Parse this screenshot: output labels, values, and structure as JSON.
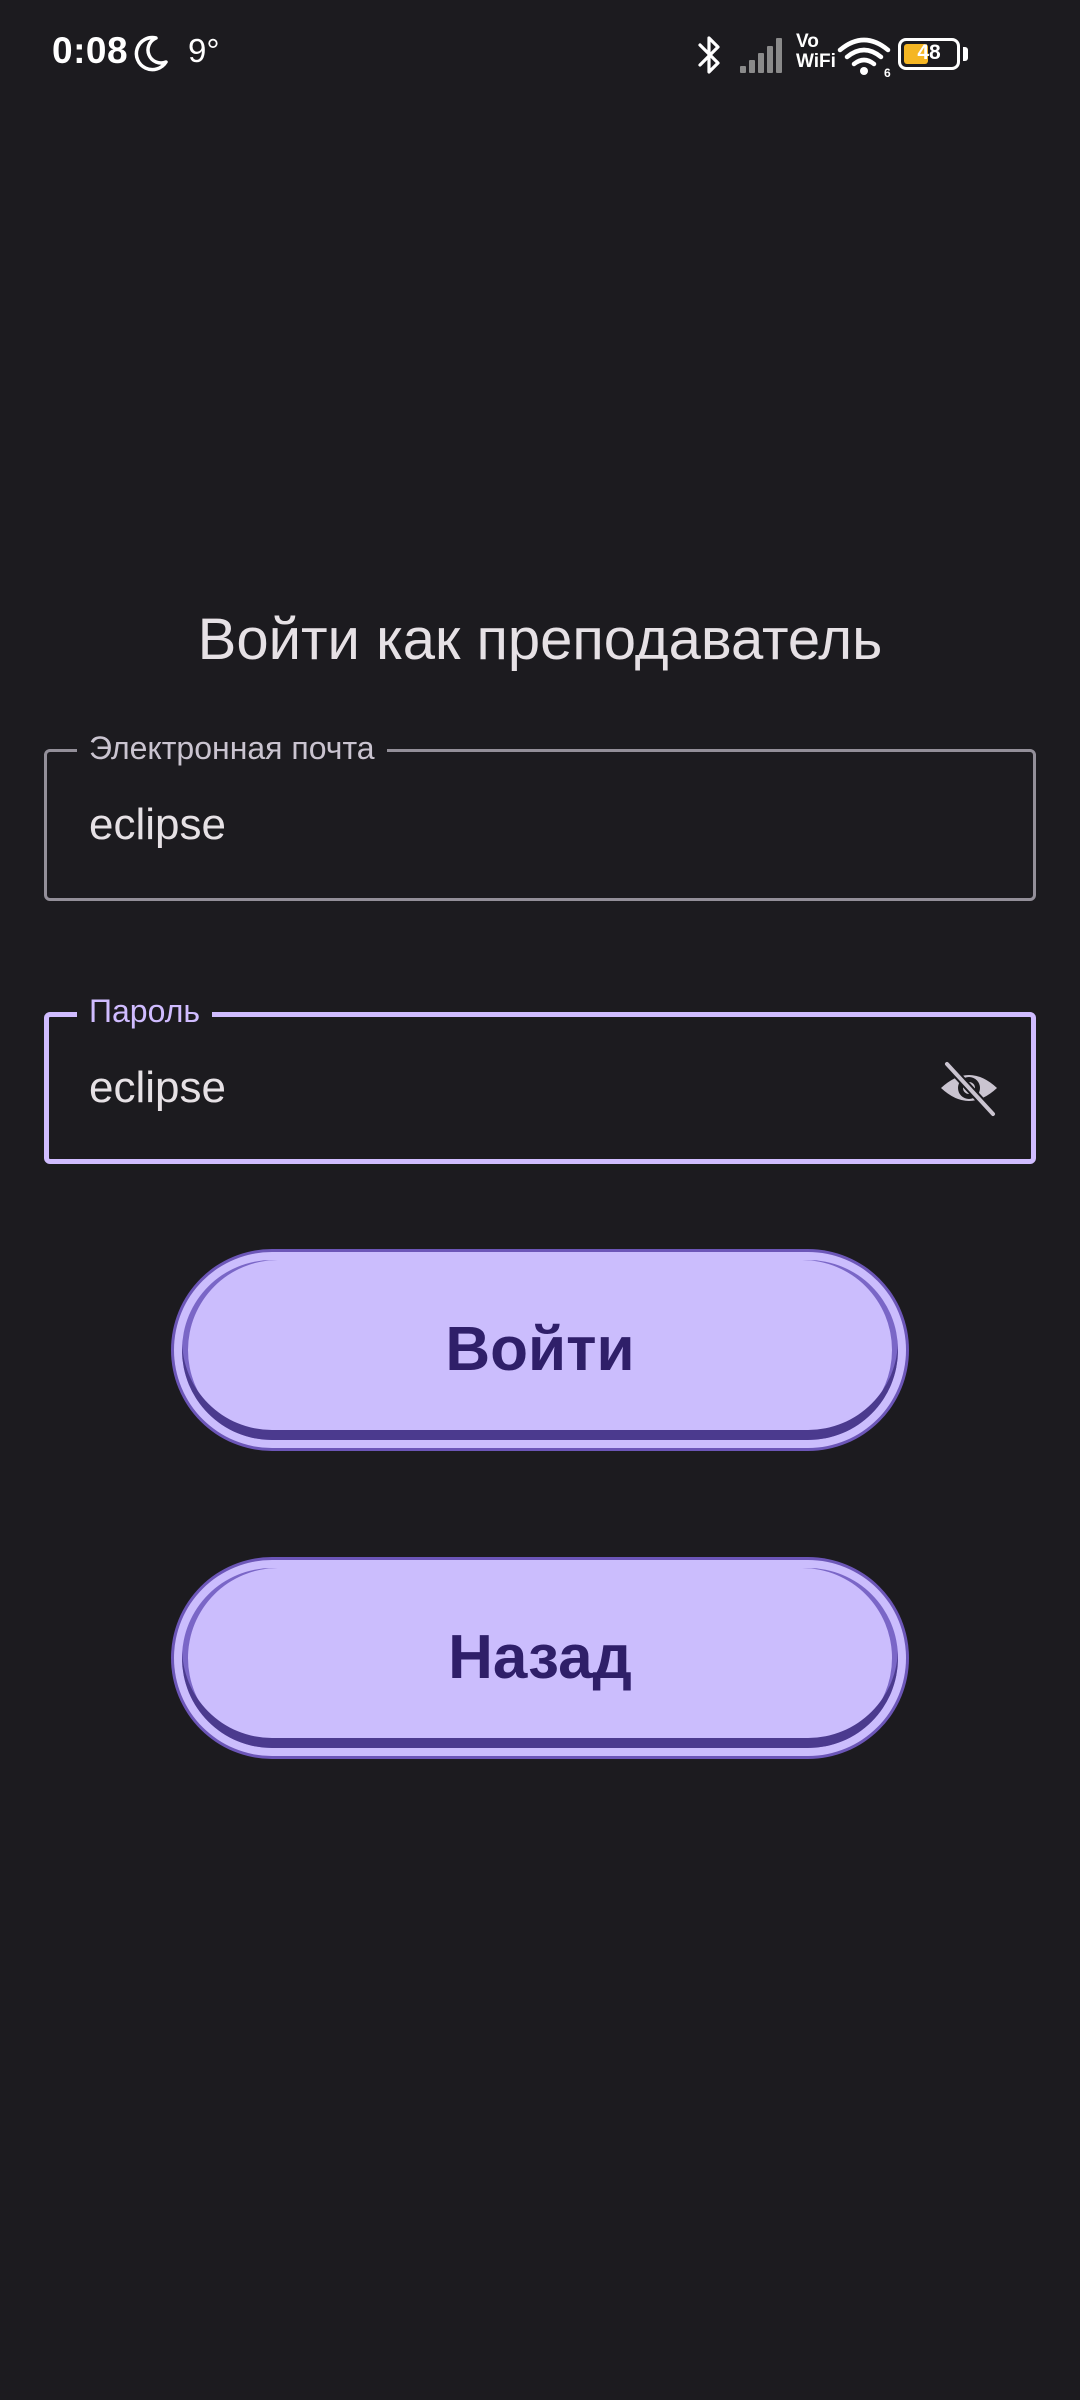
{
  "status_bar": {
    "time": "0:08",
    "temperature": "9°",
    "vowifi_line1": "Vo",
    "vowifi_line2": "WiFi",
    "wifi_badge": "6",
    "battery_level": "48",
    "battery_fraction": 0.48,
    "icons": [
      "moon-icon",
      "bluetooth-icon",
      "signal-icon",
      "vowifi-icon",
      "wifi-icon",
      "battery-icon"
    ]
  },
  "login": {
    "title": "Войти как преподаватель",
    "email": {
      "label": "Электронная почта",
      "value": "eclipse"
    },
    "password": {
      "label": "Пароль",
      "value": "eclipse",
      "toggle_icon": "eye-off-icon"
    },
    "login_button": "Войти",
    "back_button": "Назад"
  },
  "colors": {
    "background": "#1c1b1f",
    "accent": "#d0bcff",
    "button_fill": "#cbbdfd",
    "button_text": "#2f1f69",
    "outline": "#938f99",
    "battery_fill": "#f5b623"
  }
}
